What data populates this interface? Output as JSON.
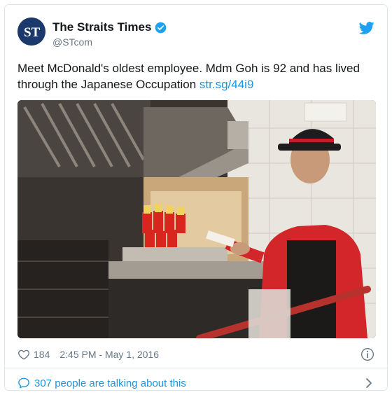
{
  "tweet": {
    "author_name": "The Straits Times",
    "author_handle": "@STcom",
    "avatar_letters": "ST",
    "text": "Meet McDonald's oldest employee. Mdm Goh is 92 and has lived through the Japanese Occupation ",
    "link_text": "str.sg/44i9",
    "like_count": "184",
    "timestamp": "2:45 PM - May 1, 2016"
  },
  "footer": {
    "talking_text": "307 people are talking about this"
  },
  "colors": {
    "link_blue": "#1b95e0",
    "muted_grey": "#657786",
    "avatar_navy": "#1b3a6b",
    "border": "#e1e8ed"
  },
  "icons": {
    "verified": "verified-badge-icon",
    "brand": "twitter-bird-icon",
    "like": "heart-icon",
    "info": "info-icon",
    "conversation": "speech-bubble-icon",
    "more": "chevron-right-icon"
  }
}
